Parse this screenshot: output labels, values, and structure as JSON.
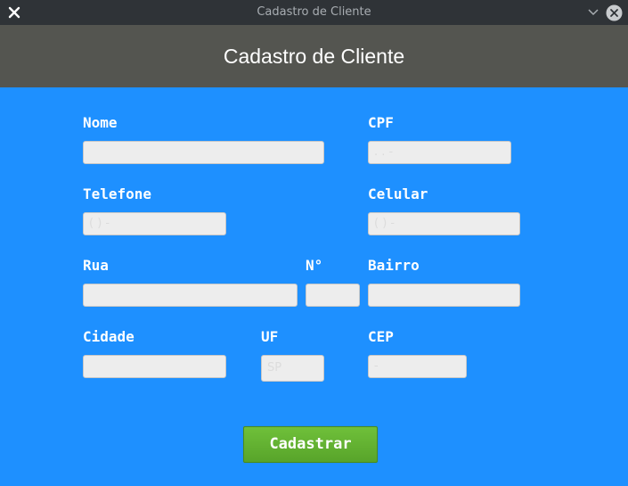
{
  "window": {
    "title": "Cadastro de Cliente"
  },
  "header": {
    "title": "Cadastro de Cliente"
  },
  "form": {
    "nome_label": "Nome",
    "cpf_label": "CPF",
    "telefone_label": "Telefone",
    "celular_label": "Celular",
    "rua_label": "Rua",
    "numero_label": "N°",
    "bairro_label": "Bairro",
    "cidade_label": "Cidade",
    "uf_label": "UF",
    "cep_label": "CEP",
    "cpf_value": "   .   .   -  ",
    "telefone_value": "(  )     -    ",
    "celular_value": "(  )      -    ",
    "uf_value": "SP",
    "cep_value": "     -   "
  },
  "actions": {
    "submit_label": "Cadastrar"
  },
  "colors": {
    "background": "#1e90ff",
    "header": "#545550",
    "titlebar": "#2f3337",
    "button": "#62b030"
  }
}
